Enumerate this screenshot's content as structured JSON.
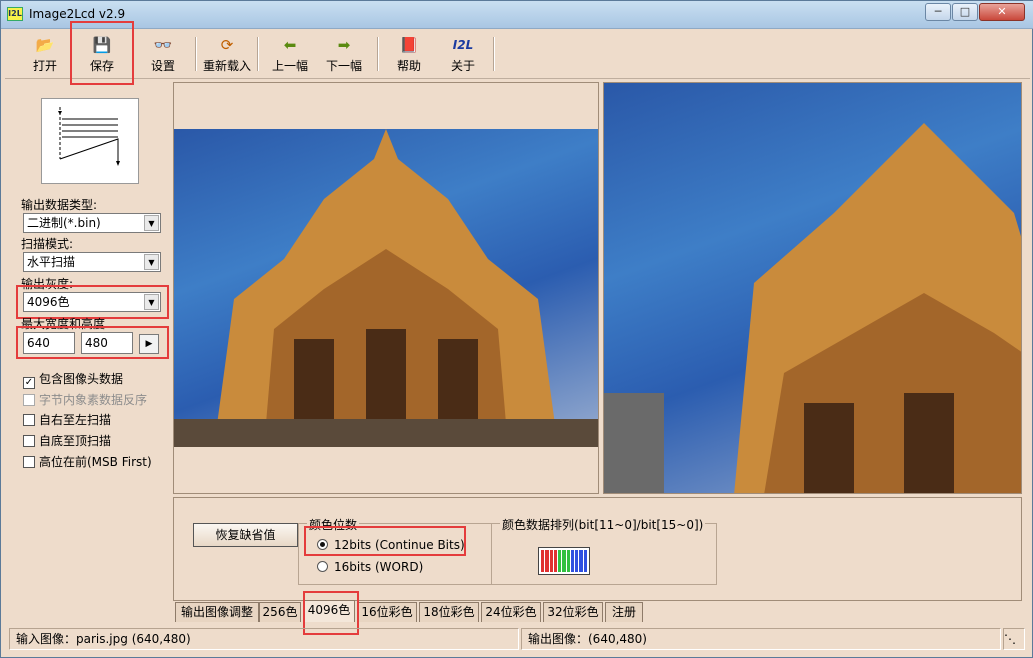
{
  "window": {
    "title": "Image2Lcd v2.9",
    "app_icon": "I2L"
  },
  "toolbar": {
    "items": [
      {
        "label": "打开",
        "icon": "folder-open-icon"
      },
      {
        "label": "保存",
        "icon": "floppy-disk-icon"
      },
      {
        "label": "设置",
        "icon": "glasses-icon"
      },
      {
        "label": "重新载入",
        "icon": "reload-icon"
      },
      {
        "label": "上一幅",
        "icon": "arrow-left-icon"
      },
      {
        "label": "下一幅",
        "icon": "arrow-right-icon"
      },
      {
        "label": "帮助",
        "icon": "help-book-icon"
      },
      {
        "label": "关于",
        "icon": "about-logo-icon"
      }
    ],
    "about_logo_text": "I2L"
  },
  "left_panel": {
    "output_type_label": "输出数据类型:",
    "output_type_value": "二进制(*.bin)",
    "scan_mode_label": "扫描模式:",
    "scan_mode_value": "水平扫描",
    "gray_label": "输出灰度:",
    "gray_value": "4096色",
    "max_size_label": "最大宽度和高度",
    "max_width": "640",
    "max_height": "480",
    "checkboxes": [
      {
        "label": "包含图像头数据",
        "checked": true,
        "disabled": false
      },
      {
        "label": "字节内象素数据反序",
        "checked": false,
        "disabled": true
      },
      {
        "label": "自右至左扫描",
        "checked": false,
        "disabled": false
      },
      {
        "label": "自底至顶扫描",
        "checked": false,
        "disabled": false
      },
      {
        "label": "高位在前(MSB First)",
        "checked": false,
        "disabled": false
      }
    ]
  },
  "bottom_panel": {
    "restore_button": "恢复缺省值",
    "color_bits_title": "颜色位数",
    "radio_12": "12bits (Continue Bits)",
    "radio_16": "16bits (WORD)",
    "selected_radio": "12bits (Continue Bits)",
    "color_order_title": "颜色数据排列(bit[11~0]/bit[15~0])",
    "color_order_colors": [
      "#e03030",
      "#e03030",
      "#e03030",
      "#e03030",
      "#30c040",
      "#30c040",
      "#30c040",
      "#3050e0",
      "#3050e0",
      "#3050e0",
      "#3050e0"
    ]
  },
  "tabs": [
    {
      "label": "输出图像调整",
      "active": false
    },
    {
      "label": "256色",
      "active": false
    },
    {
      "label": "4096色",
      "active": true
    },
    {
      "label": "16位彩色",
      "active": false
    },
    {
      "label": "18位彩色",
      "active": false
    },
    {
      "label": "24位彩色",
      "active": false
    },
    {
      "label": "32位彩色",
      "active": false
    },
    {
      "label": "注册",
      "active": false
    }
  ],
  "status": {
    "input": "输入图像：paris.jpg (640,480)",
    "output": "输出图像：(640,480)"
  },
  "colors": {
    "highlight": "#e43c3c",
    "panel_bg": "#eedccb"
  }
}
